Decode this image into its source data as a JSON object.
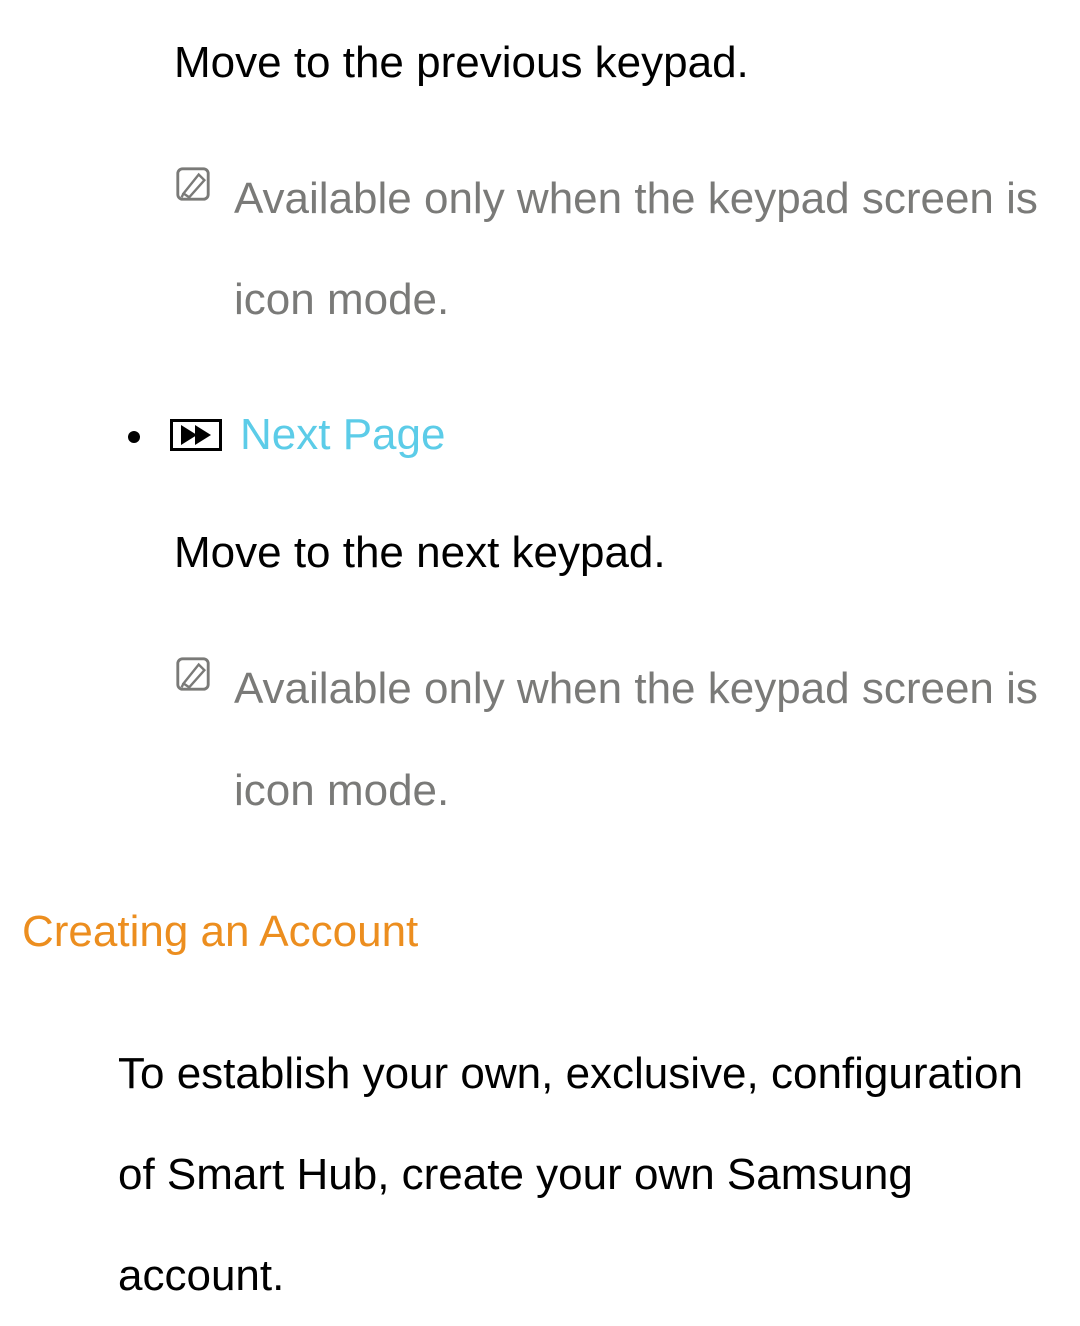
{
  "item_prev": {
    "description": "Move to the previous keypad.",
    "note": "Available only when the keypad screen is icon mode."
  },
  "item_next": {
    "label": "Next Page",
    "description": "Move to the next keypad.",
    "note": "Available only when the keypad screen is icon mode."
  },
  "section": {
    "heading": "Creating an Account",
    "body": "To establish your own, exclusive, configuration of Smart Hub, create your own Samsung account."
  }
}
